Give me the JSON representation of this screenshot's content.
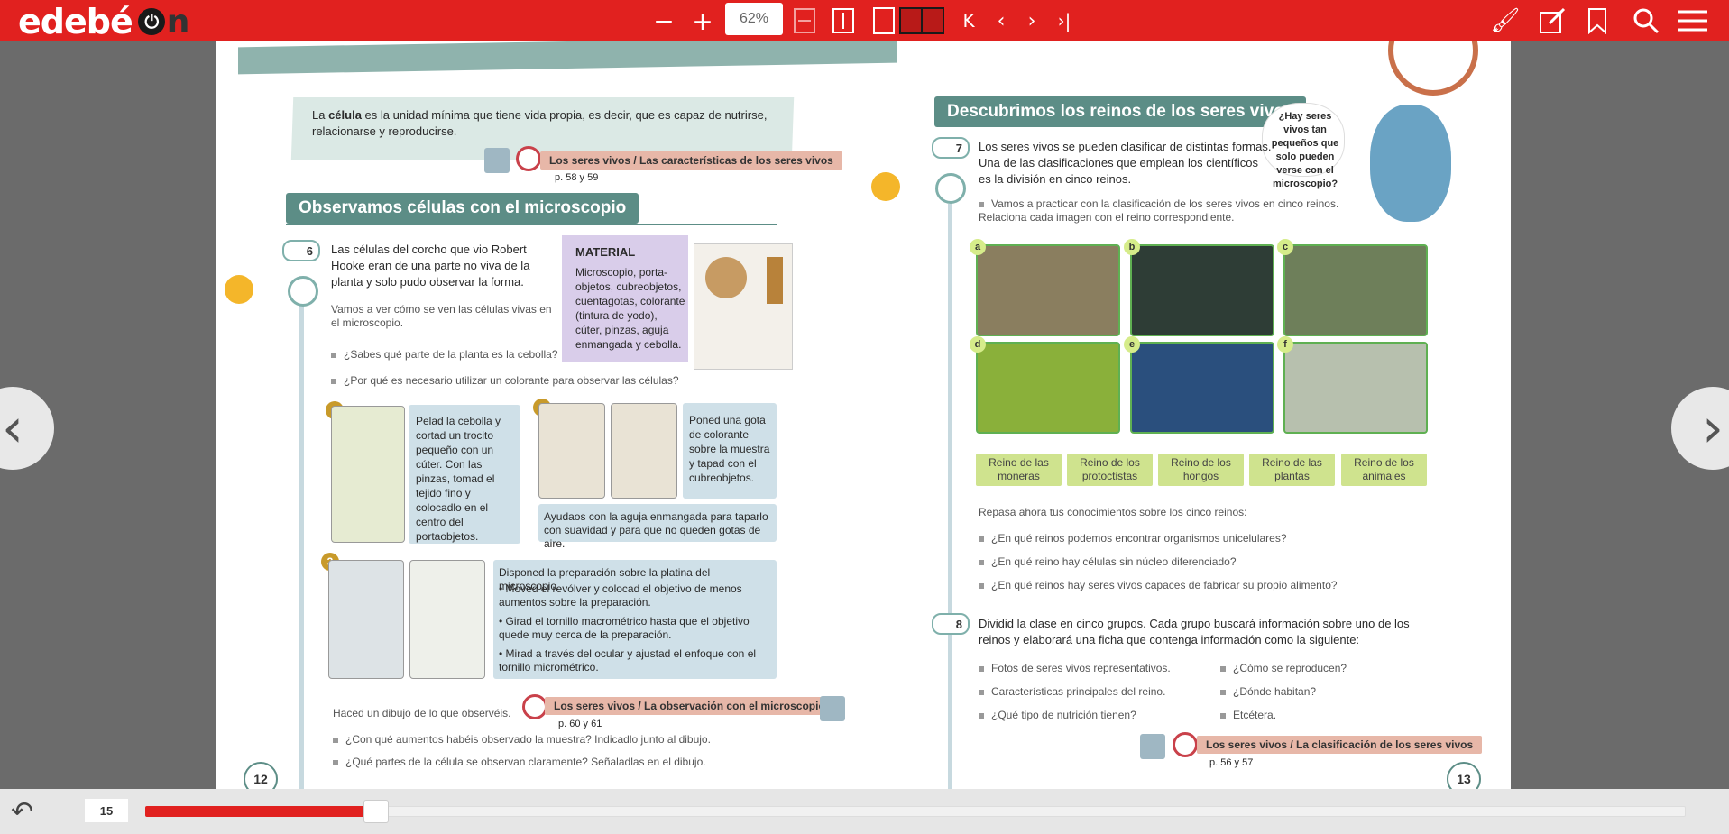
{
  "toolbar": {
    "logo": "edebé",
    "logo_on_n": "n",
    "zoom": "62%"
  },
  "bottom": {
    "page": "15",
    "progress": 0.12
  },
  "left_page": {
    "definition_pre": "La ",
    "definition_bold": "célula",
    "definition_post": " es la unidad mínima que tiene vida propia, es decir, que es capaz de nutrirse, relacionarse y reproducirse.",
    "ref1": "Los seres vivos / Las características de los seres vivos",
    "ref1_pages": "p. 58 y 59",
    "banner": "Observamos células con el microscopio",
    "activity_num": "6",
    "activity_text": "Las células del corcho que vio Robert Hooke eran de una parte no viva de la planta y solo pudo observar la forma.",
    "intro": "Vamos a ver cómo se ven las células vivas en el microscopio.",
    "q1": "¿Sabes qué parte de la planta es la cebolla?",
    "q2": "¿Por qué es necesario utilizar un colorante para observar las células?",
    "material_title": "MATERIAL",
    "material_text": "Microscopio, porta-objetos, cubreobjetos, cuentagotas, colorante (tintura de yodo), cúter, pinzas, aguja enmangada y cebolla.",
    "step1_num": "1",
    "step1_text": "Pelad la cebolla y cortad un trocito pequeño con un cúter. Con las pinzas, tomad el tejido fino y colocadlo en el centro del portaobjetos.",
    "step2_num": "2",
    "step2_text": "Poned una gota de colorante sobre la muestra y tapad con el cubreobjetos.",
    "step2_note": "Ayudaos con la aguja enmangada para taparlo con suavidad y para que no queden gotas de aire.",
    "step3_num": "3",
    "step3_intro": "Disponed la preparación sobre la platina del microscopio.",
    "step3_b1": "• Moved el revólver y colocad el objetivo de menos aumentos sobre la preparación.",
    "step3_b2": "• Girad el tornillo macrométrico hasta que el objetivo quede muy cerca de la preparación.",
    "step3_b3": "• Mirad a través del ocular y ajustad el enfoque con el tornillo micrométrico.",
    "draw": "Haced un dibujo de lo que observéis.",
    "ref2": "Los seres vivos / La observación con el microscopio",
    "ref2_pages": "p. 60 y 61",
    "q3": "¿Con qué aumentos habéis observado la muestra? Indicadlo junto al dibujo.",
    "q4": "¿Qué partes de la célula se observan claramente? Señaladlas en el dibujo.",
    "page_number": "12"
  },
  "right_page": {
    "banner": "Descubrimos los reinos de los seres vivos",
    "bubble": "¿Hay seres vivos tan pequeños que solo pueden verse con el microscopio?",
    "activity7_num": "7",
    "activity7_text": "Los seres vivos se pueden clasificar de distintas formas. Una de las clasificaciones que emplean los científicos es la división en cinco reinos.",
    "activity7_task": "Vamos a practicar con la clasificación de los seres vivos en cinco reinos. Relaciona cada imagen con el reino correspondiente.",
    "tiles": [
      "a",
      "b",
      "c",
      "d",
      "e",
      "f"
    ],
    "kingdoms": [
      "Reino de las moneras",
      "Reino de los protoctistas",
      "Reino de los hongos",
      "Reino de las plantas",
      "Reino de los animales"
    ],
    "review": "Repasa ahora tus conocimientos sobre los cinco reinos:",
    "rq1": "¿En qué reinos podemos encontrar organismos unicelulares?",
    "rq2": "¿En qué reino hay células sin núcleo diferenciado?",
    "rq3": "¿En qué reinos hay seres vivos capaces de fabricar su propio alimento?",
    "activity8_num": "8",
    "activity8_text": "Dividid la clase en cinco grupos. Cada grupo buscará información sobre uno de los reinos y elaborará una ficha que contenga información como la siguiente:",
    "list_left": [
      "Fotos de seres vivos representativos.",
      "Características principales del reino.",
      "¿Qué tipo de nutrición tienen?"
    ],
    "list_right": [
      "¿Cómo se reproducen?",
      "¿Dónde habitan?",
      "Etcétera."
    ],
    "ref3": "Los seres vivos / La clasificación de los seres vivos",
    "ref3_pages": "p. 56 y 57",
    "page_number": "13"
  }
}
